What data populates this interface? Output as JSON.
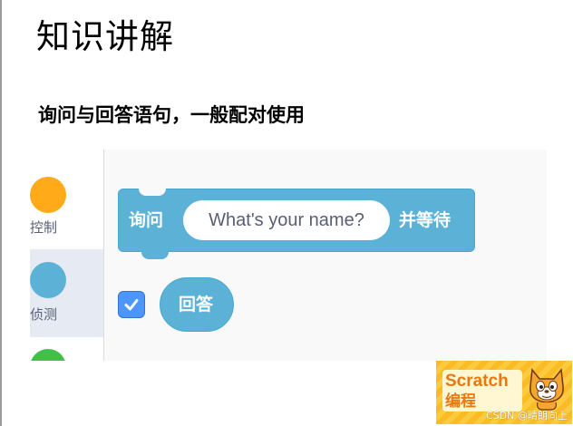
{
  "slide": {
    "title": "知识讲解",
    "subtitle": "询问与回答语句，一般配对使用"
  },
  "palette": {
    "categories": [
      {
        "label": "控制",
        "color": "#ffab19",
        "selected": false
      },
      {
        "label": "侦测",
        "color": "#5cb1d6",
        "selected": true
      },
      {
        "label": "",
        "color": "#40bf4a",
        "selected": false
      }
    ]
  },
  "ask_block": {
    "label": "询问",
    "input_value": "What's your name?",
    "suffix": "并等待",
    "color": "#5cb1d6"
  },
  "answer_block": {
    "checked": true,
    "label": "回答"
  },
  "logo": {
    "line1": "Scratch",
    "line2": "编程"
  },
  "watermark": "CSDN @晴朗向上"
}
